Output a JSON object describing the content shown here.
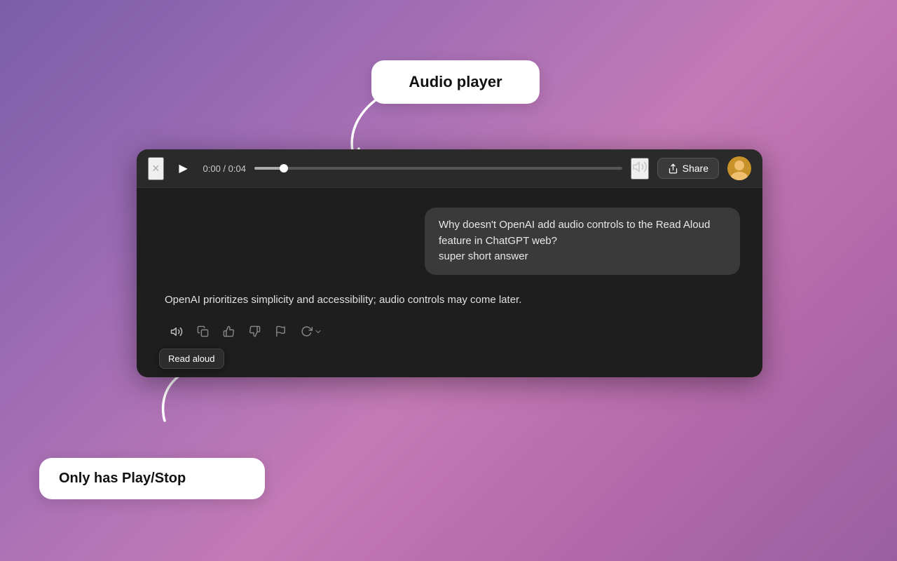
{
  "background": {
    "gradient_start": "#7b5ea7",
    "gradient_end": "#9a5fa0"
  },
  "callout_audio": {
    "label": "Audio player"
  },
  "callout_play": {
    "label": "Only has Play/Stop"
  },
  "audio_bar": {
    "time": "0:00 / 0:04",
    "share_label": "Share",
    "close_icon": "×",
    "play_icon": "▶",
    "volume_icon": "🔊"
  },
  "user_message": {
    "text": "Why doesn't OpenAI add audio controls to the Read Aloud feature in ChatGPT web?\nsuper short answer"
  },
  "ai_response": {
    "text": "OpenAI prioritizes simplicity and accessibility; audio controls may come later."
  },
  "toolbar": {
    "read_aloud_icon": "🔊",
    "copy_icon": "⧉",
    "thumbs_up_icon": "👍",
    "thumbs_down_icon": "👎",
    "flag_icon": "⚑",
    "refresh_icon": "↻",
    "tooltip_label": "Read aloud"
  }
}
